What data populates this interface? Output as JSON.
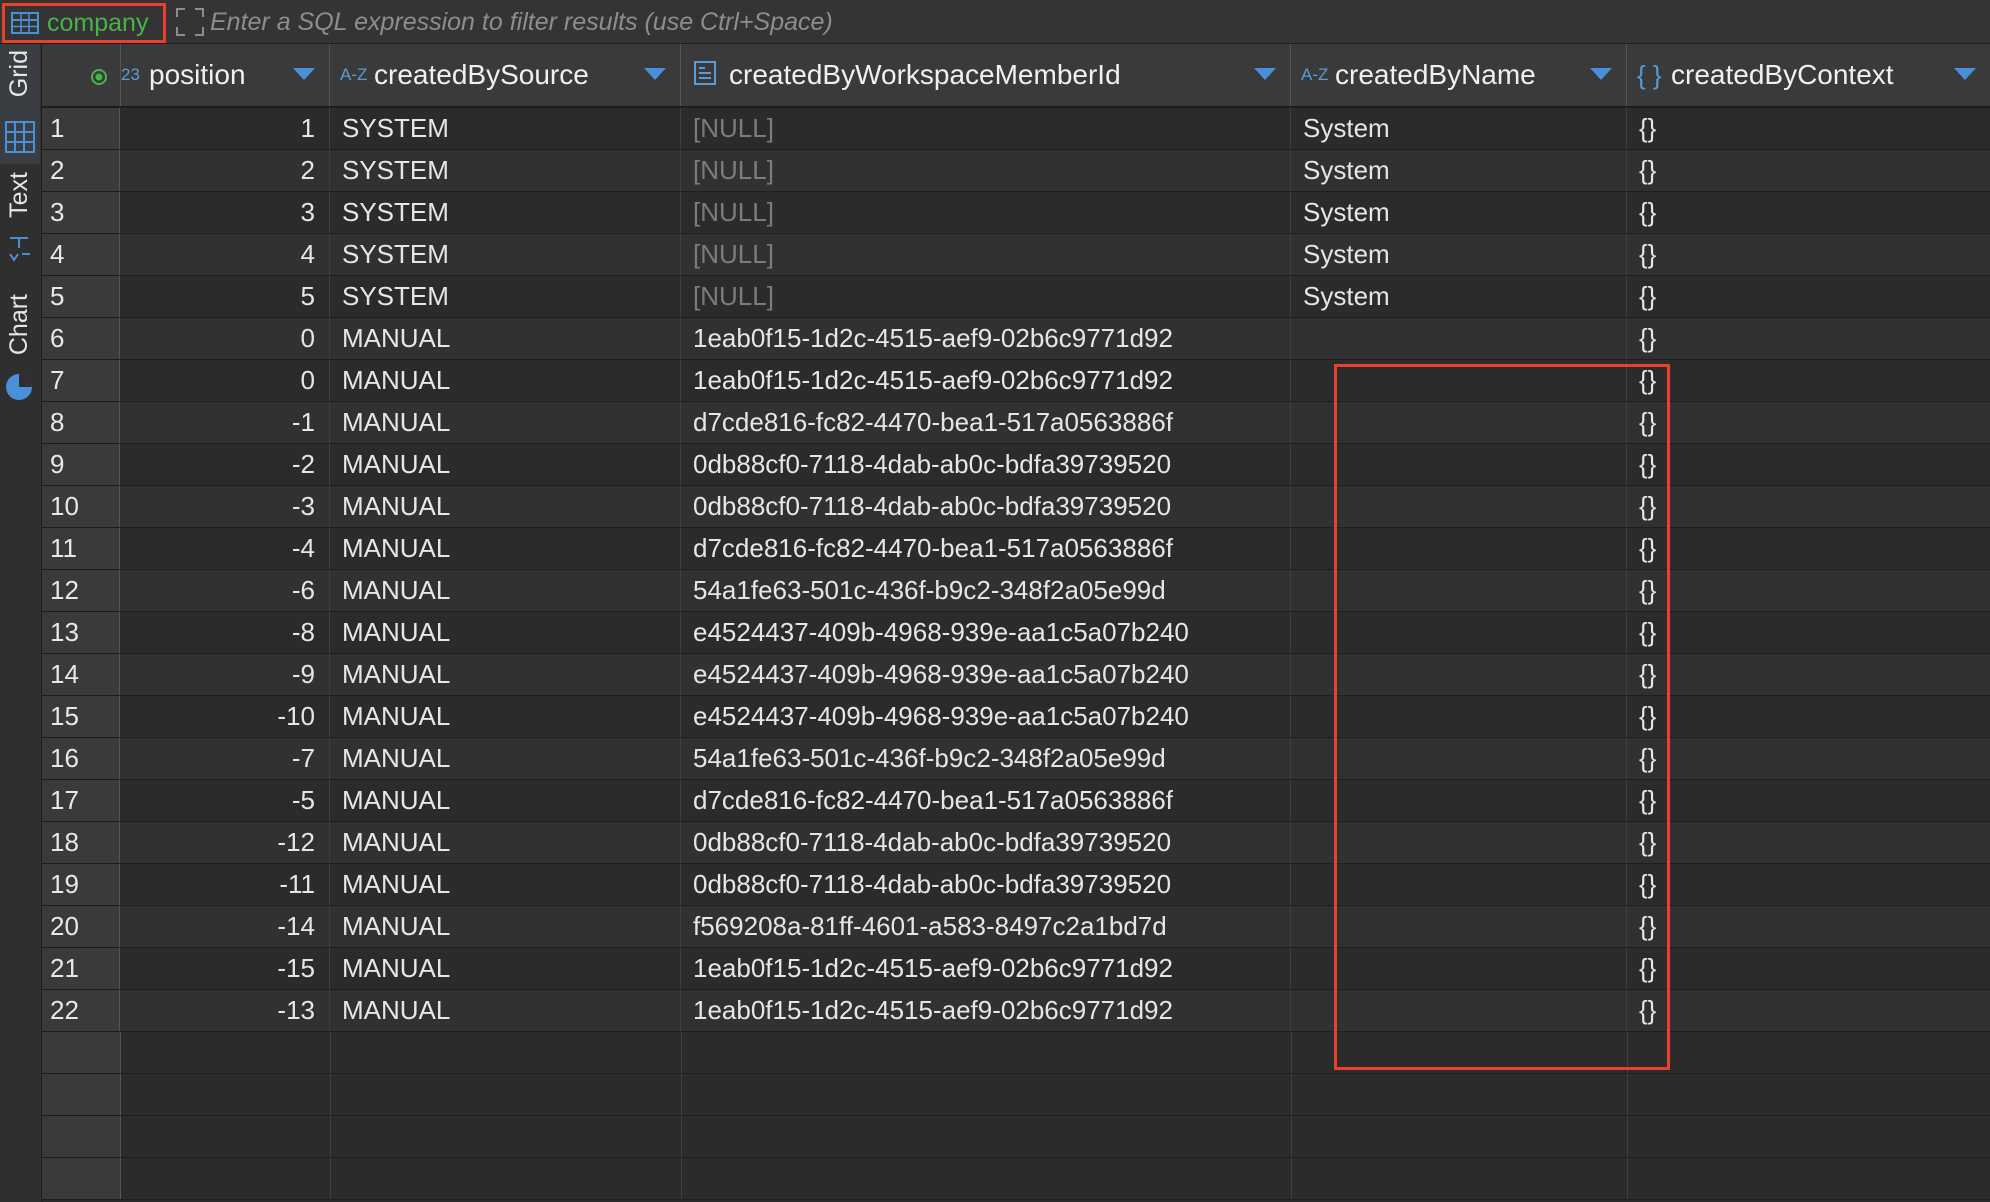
{
  "table": {
    "name": "company"
  },
  "filter": {
    "placeholder": "Enter a SQL expression to filter results (use Ctrl+Space)"
  },
  "side_tabs": {
    "grid": "Grid",
    "text": "Text",
    "chart": "Chart"
  },
  "columns": [
    {
      "type": "23",
      "name": "position"
    },
    {
      "type": "A-Z",
      "name": "createdBySource"
    },
    {
      "type": "",
      "name": "createdByWorkspaceMemberId"
    },
    {
      "type": "A-Z",
      "name": "createdByName"
    },
    {
      "type": "{ }",
      "name": "createdByContext"
    }
  ],
  "rows": [
    {
      "num": "1",
      "position": "1",
      "source": "SYSTEM",
      "member_id": "[NULL]",
      "name": "System",
      "context": "{}"
    },
    {
      "num": "2",
      "position": "2",
      "source": "SYSTEM",
      "member_id": "[NULL]",
      "name": "System",
      "context": "{}"
    },
    {
      "num": "3",
      "position": "3",
      "source": "SYSTEM",
      "member_id": "[NULL]",
      "name": "System",
      "context": "{}"
    },
    {
      "num": "4",
      "position": "4",
      "source": "SYSTEM",
      "member_id": "[NULL]",
      "name": "System",
      "context": "{}"
    },
    {
      "num": "5",
      "position": "5",
      "source": "SYSTEM",
      "member_id": "[NULL]",
      "name": "System",
      "context": "{}"
    },
    {
      "num": "6",
      "position": "0",
      "source": "MANUAL",
      "member_id": "1eab0f15-1d2c-4515-aef9-02b6c9771d92",
      "name": "",
      "context": "{}"
    },
    {
      "num": "7",
      "position": "0",
      "source": "MANUAL",
      "member_id": "1eab0f15-1d2c-4515-aef9-02b6c9771d92",
      "name": "",
      "context": "{}"
    },
    {
      "num": "8",
      "position": "-1",
      "source": "MANUAL",
      "member_id": "d7cde816-fc82-4470-bea1-517a0563886f",
      "name": "",
      "context": "{}"
    },
    {
      "num": "9",
      "position": "-2",
      "source": "MANUAL",
      "member_id": "0db88cf0-7118-4dab-ab0c-bdfa39739520",
      "name": "",
      "context": "{}"
    },
    {
      "num": "10",
      "position": "-3",
      "source": "MANUAL",
      "member_id": "0db88cf0-7118-4dab-ab0c-bdfa39739520",
      "name": "",
      "context": "{}"
    },
    {
      "num": "11",
      "position": "-4",
      "source": "MANUAL",
      "member_id": "d7cde816-fc82-4470-bea1-517a0563886f",
      "name": "",
      "context": "{}"
    },
    {
      "num": "12",
      "position": "-6",
      "source": "MANUAL",
      "member_id": "54a1fe63-501c-436f-b9c2-348f2a05e99d",
      "name": "",
      "context": "{}"
    },
    {
      "num": "13",
      "position": "-8",
      "source": "MANUAL",
      "member_id": "e4524437-409b-4968-939e-aa1c5a07b240",
      "name": "",
      "context": "{}"
    },
    {
      "num": "14",
      "position": "-9",
      "source": "MANUAL",
      "member_id": "e4524437-409b-4968-939e-aa1c5a07b240",
      "name": "",
      "context": "{}"
    },
    {
      "num": "15",
      "position": "-10",
      "source": "MANUAL",
      "member_id": "e4524437-409b-4968-939e-aa1c5a07b240",
      "name": "",
      "context": "{}"
    },
    {
      "num": "16",
      "position": "-7",
      "source": "MANUAL",
      "member_id": "54a1fe63-501c-436f-b9c2-348f2a05e99d",
      "name": "",
      "context": "{}"
    },
    {
      "num": "17",
      "position": "-5",
      "source": "MANUAL",
      "member_id": "d7cde816-fc82-4470-bea1-517a0563886f",
      "name": "",
      "context": "{}"
    },
    {
      "num": "18",
      "position": "-12",
      "source": "MANUAL",
      "member_id": "0db88cf0-7118-4dab-ab0c-bdfa39739520",
      "name": "",
      "context": "{}"
    },
    {
      "num": "19",
      "position": "-11",
      "source": "MANUAL",
      "member_id": "0db88cf0-7118-4dab-ab0c-bdfa39739520",
      "name": "",
      "context": "{}"
    },
    {
      "num": "20",
      "position": "-14",
      "source": "MANUAL",
      "member_id": "f569208a-81ff-4601-a583-8497c2a1bd7d",
      "name": "",
      "context": "{}"
    },
    {
      "num": "21",
      "position": "-15",
      "source": "MANUAL",
      "member_id": "1eab0f15-1d2c-4515-aef9-02b6c9771d92",
      "name": "",
      "context": "{}"
    },
    {
      "num": "22",
      "position": "-13",
      "source": "MANUAL",
      "member_id": "1eab0f15-1d2c-4515-aef9-02b6c9771d92",
      "name": "",
      "context": "{}"
    }
  ],
  "colors": {
    "highlight": "#e8412c",
    "table_name": "#49b249",
    "accent": "#4a90d9",
    "null_text": "#7c7c7c"
  },
  "icons": {
    "table": "table-icon",
    "expand": "expand-icon",
    "grid": "grid-icon",
    "text": "text-icon",
    "chart": "pie-chart-icon",
    "sort": "sort-arrow-icon",
    "key": "key-indicator-icon"
  }
}
